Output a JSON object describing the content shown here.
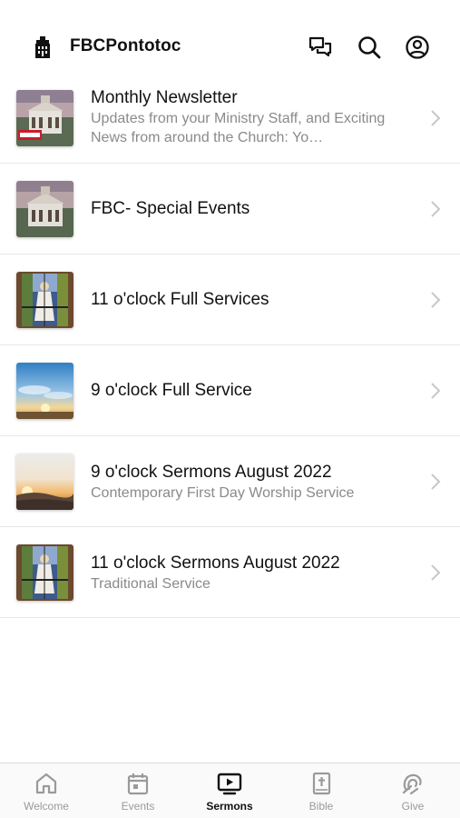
{
  "header": {
    "app_title": "FBCPontotoc",
    "icons": [
      "church-logo-icon",
      "chat-icon",
      "search-icon",
      "account-icon"
    ]
  },
  "list": [
    {
      "title": "Monthly Newsletter",
      "subtitle": "Updates from your Ministry Staff, and Exciting News from around the Church: Yo…",
      "thumbnail": "church-building"
    },
    {
      "title": "FBC- Special Events",
      "subtitle": "",
      "thumbnail": "church-building"
    },
    {
      "title": "11 o'clock Full Services",
      "subtitle": "",
      "thumbnail": "stained-glass"
    },
    {
      "title": "9 o'clock Full Service",
      "subtitle": "",
      "thumbnail": "sunrise-sky"
    },
    {
      "title": "9 o'clock Sermons August 2022",
      "subtitle": "Contemporary First Day Worship Service",
      "thumbnail": "sunset-horizon"
    },
    {
      "title": "11 o'clock Sermons August 2022",
      "subtitle": "Traditional Service",
      "thumbnail": "stained-glass"
    }
  ],
  "tabs": [
    {
      "label": "Welcome",
      "icon": "home-icon",
      "active": false
    },
    {
      "label": "Events",
      "icon": "calendar-icon",
      "active": false
    },
    {
      "label": "Sermons",
      "icon": "tv-play-icon",
      "active": true
    },
    {
      "label": "Bible",
      "icon": "bible-icon",
      "active": false
    },
    {
      "label": "Give",
      "icon": "give-icon",
      "active": false
    }
  ],
  "colors": {
    "text": "#111111",
    "subtext": "#8a8a8a",
    "divider": "#e6e6e6",
    "tab_inactive": "#9a9a9a",
    "tab_active": "#111111"
  }
}
